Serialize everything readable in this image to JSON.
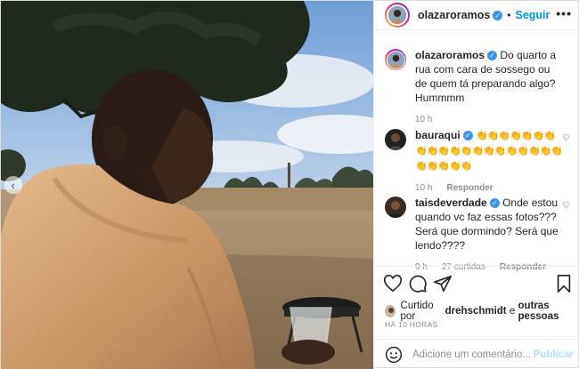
{
  "post": {
    "author": "olazaroramos",
    "follow_label": "Seguir",
    "dot": "•",
    "more_label": "•••",
    "caption_author": "olazaroramos",
    "caption_text": "Do quarto a rua com cara de sossego ou de quem tá preparando algo? Hummmm",
    "caption_time": "10 h",
    "nav_prev": "‹"
  },
  "comments": [
    {
      "author": "bauraqui",
      "text": "👏👏👏👏👏👏👏👏👏👏👏👏👏👏👏👏👏👏👏👏👏👏👏👏👏",
      "time": "10 h",
      "reply_label": "Responder"
    },
    {
      "author": "taisdeverdade",
      "text": "Onde estou quando vc faz essas fotos??? Será que dormindo? Será que lendo????",
      "time": "9 h",
      "likes": "27 curtidas",
      "reply_label": "Responder"
    }
  ],
  "likes": {
    "prefix": "Curtido por",
    "user": "drehschmidt",
    "connector": "e",
    "others": "outras pessoas"
  },
  "timestamp": "HÁ 10 HORAS",
  "add_comment": {
    "placeholder": "Adicione um comentário...",
    "publish_label": "Publicar"
  },
  "colors": {
    "accent": "#0095f6",
    "verified": "#3897f0",
    "publish_disabled": "#b2dffc",
    "muted": "#8e8e8e"
  },
  "icons": [
    "heart-icon",
    "comment-icon",
    "share-icon",
    "bookmark-icon",
    "emoji-icon",
    "verified-icon",
    "more-icon"
  ]
}
